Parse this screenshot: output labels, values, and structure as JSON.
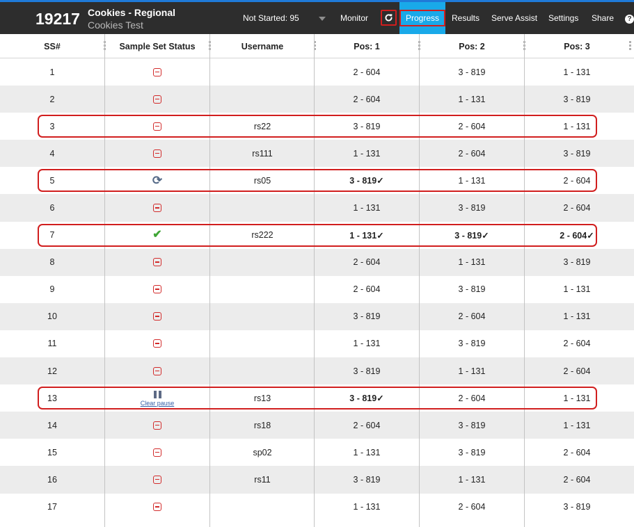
{
  "header": {
    "study_id": "19217",
    "study_title": "Cookies - Regional",
    "study_subtitle": "Cookies Test",
    "status_selector": "Not Started: 95",
    "nav": {
      "monitor": "Monitor",
      "progress": "Progress",
      "results": "Results",
      "serve_assist": "Serve Assist",
      "settings": "Settings",
      "share": "Share"
    },
    "refresh_icon": "refresh-icon",
    "help_icon": "question-circle-icon",
    "help_glyph": "?"
  },
  "colors": {
    "header_bg": "#2d2d2d",
    "active_tab": "#19a9e9",
    "highlight": "#d11e1e",
    "alt_row": "#ececec"
  },
  "table": {
    "columns": [
      "SS#",
      "Sample Set Status",
      "Username",
      "Pos: 1",
      "Pos: 2",
      "Pos: 3"
    ],
    "rows": [
      {
        "ss": "1",
        "status": "not-started",
        "username": "",
        "pos1": "2 - 604",
        "pos2": "3 - 819",
        "pos3": "1 - 131"
      },
      {
        "ss": "2",
        "status": "not-started",
        "username": "",
        "pos1": "2 - 604",
        "pos2": "1 - 131",
        "pos3": "3 - 819"
      },
      {
        "ss": "3",
        "status": "not-started",
        "username": "rs22",
        "pos1": "3 - 819",
        "pos2": "2 - 604",
        "pos3": "1 - 131"
      },
      {
        "ss": "4",
        "status": "not-started",
        "username": "rs111",
        "pos1": "1 - 131",
        "pos2": "2 - 604",
        "pos3": "3 - 819"
      },
      {
        "ss": "5",
        "status": "in-progress",
        "username": "rs05",
        "pos1": "3 - 819✓",
        "pos2": "1 - 131",
        "pos3": "2 - 604",
        "done": [
          true,
          false,
          false
        ]
      },
      {
        "ss": "6",
        "status": "not-started",
        "username": "",
        "pos1": "1 - 131",
        "pos2": "3 - 819",
        "pos3": "2 - 604"
      },
      {
        "ss": "7",
        "status": "complete",
        "username": "rs222",
        "pos1": "1 - 131✓",
        "pos2": "3 - 819✓",
        "pos3": "2 - 604✓",
        "done": [
          true,
          true,
          true
        ]
      },
      {
        "ss": "8",
        "status": "not-started",
        "username": "",
        "pos1": "2 - 604",
        "pos2": "1 - 131",
        "pos3": "3 - 819"
      },
      {
        "ss": "9",
        "status": "not-started",
        "username": "",
        "pos1": "2 - 604",
        "pos2": "3 - 819",
        "pos3": "1 - 131"
      },
      {
        "ss": "10",
        "status": "not-started",
        "username": "",
        "pos1": "3 - 819",
        "pos2": "2 - 604",
        "pos3": "1 - 131"
      },
      {
        "ss": "11",
        "status": "not-started",
        "username": "",
        "pos1": "1 - 131",
        "pos2": "3 - 819",
        "pos3": "2 - 604"
      },
      {
        "ss": "12",
        "status": "not-started",
        "username": "",
        "pos1": "3 - 819",
        "pos2": "1 - 131",
        "pos3": "2 - 604"
      },
      {
        "ss": "13",
        "status": "paused",
        "status_link": "Clear pause",
        "username": "rs13",
        "pos1": "3 - 819✓",
        "pos2": "2 - 604",
        "pos3": "1 - 131",
        "done": [
          true,
          false,
          false
        ]
      },
      {
        "ss": "14",
        "status": "not-started",
        "username": "rs18",
        "pos1": "2 - 604",
        "pos2": "3 - 819",
        "pos3": "1 - 131"
      },
      {
        "ss": "15",
        "status": "not-started",
        "username": "sp02",
        "pos1": "1 - 131",
        "pos2": "3 - 819",
        "pos3": "2 - 604"
      },
      {
        "ss": "16",
        "status": "not-started",
        "username": "rs11",
        "pos1": "3 - 819",
        "pos2": "1 - 131",
        "pos3": "2 - 604"
      },
      {
        "ss": "17",
        "status": "not-started",
        "username": "",
        "pos1": "1 - 131",
        "pos2": "2 - 604",
        "pos3": "3 - 819"
      }
    ],
    "highlighted_rows": [
      "3",
      "5",
      "7",
      "13"
    ]
  }
}
